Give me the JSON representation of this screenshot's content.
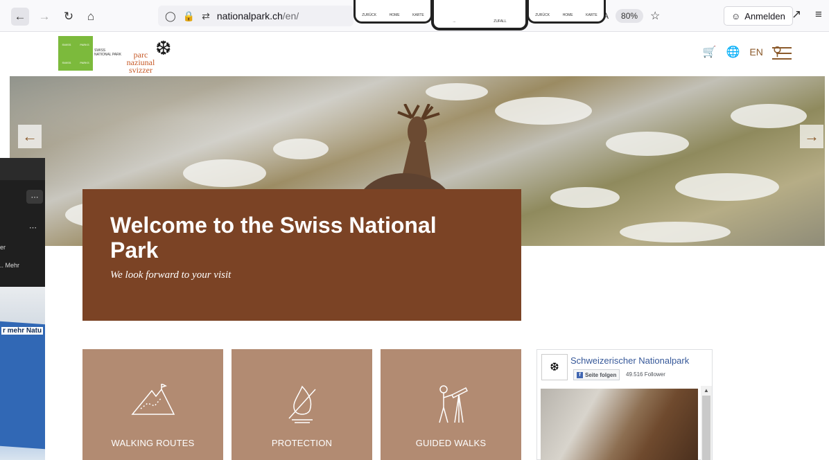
{
  "browser": {
    "url_host": "nationalpark.ch",
    "url_path": "/en/",
    "zoom": "80%",
    "signin_label": "Anmelden"
  },
  "phones": {
    "p1_labels": [
      "ZURÜCK",
      "HOME",
      "KARTE"
    ],
    "p2_labels": [
      "...",
      "ZUFALL"
    ],
    "p3_labels": [
      "ZURÜCK",
      "HOME",
      "KARTE"
    ]
  },
  "site": {
    "logo_np_text": "SWISS NATIONAL PARK",
    "logo_parc_line1": "parc",
    "logo_parc_line2": "naziunal",
    "logo_parc_line3": "svizzer",
    "lang": "EN"
  },
  "hero": {
    "title": "Welcome to the Swiss National Park",
    "subtitle": "We look forward to your visit"
  },
  "tiles": [
    {
      "label": "WALKING ROUTES",
      "icon": "mountain-route-icon"
    },
    {
      "label": "PROTECTION",
      "icon": "no-fire-icon"
    },
    {
      "label": "GUIDED WALKS",
      "icon": "hiker-telescope-icon"
    }
  ],
  "facebook": {
    "page_name": "Schweizerischer Nationalpark",
    "follow_label": "Seite folgen",
    "followers": "49.516 Follower"
  },
  "left_overlay": {
    "text1": "er",
    "text2": ".. Mehr",
    "banner": "r mehr Natu"
  },
  "colors": {
    "brand_brown": "#7b4325",
    "tile": "#b28b72",
    "accent": "#8b5a2b"
  }
}
